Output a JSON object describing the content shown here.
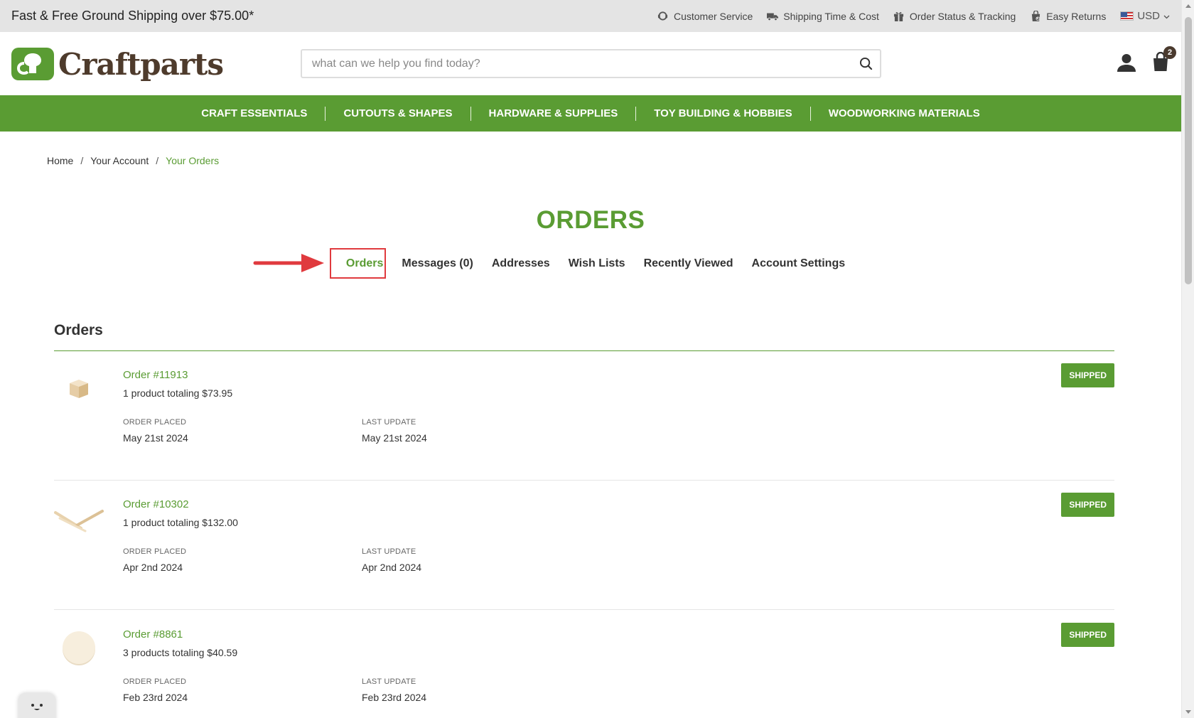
{
  "topbar": {
    "promo": "Fast & Free Ground Shipping over $75.00*",
    "links": [
      {
        "label": "Customer Service",
        "icon": "headset-icon"
      },
      {
        "label": "Shipping Time & Cost",
        "icon": "truck-icon"
      },
      {
        "label": "Order Status & Tracking",
        "icon": "gift-icon"
      },
      {
        "label": "Easy Returns",
        "icon": "return-bag-icon"
      }
    ],
    "currency": "USD"
  },
  "header": {
    "logo_text": "Craftparts",
    "search_placeholder": "what can we help you find today?",
    "cart_count": "2"
  },
  "nav": {
    "items": [
      "CRAFT ESSENTIALS",
      "CUTOUTS & SHAPES",
      "HARDWARE & SUPPLIES",
      "TOY BUILDING & HOBBIES",
      "WOODWORKING MATERIALS"
    ]
  },
  "breadcrumb": {
    "items": [
      "Home",
      "Your Account",
      "Your Orders"
    ],
    "separator": "/"
  },
  "page_title": "ORDERS",
  "tabs": [
    "Orders",
    "Messages (0)",
    "Addresses",
    "Wish Lists",
    "Recently Viewed",
    "Account Settings"
  ],
  "active_tab": "Orders",
  "orders_section": {
    "title": "Orders",
    "placed_label": "ORDER PLACED",
    "update_label": "LAST UPDATE",
    "orders": [
      {
        "number": "Order #11913",
        "total": "1 product totaling $73.95",
        "placed": "May 21st 2024",
        "updated": "May 21st 2024",
        "status": "SHIPPED",
        "thumb": "wood-cube"
      },
      {
        "number": "Order #10302",
        "total": "1 product totaling $132.00",
        "placed": "Apr 2nd 2024",
        "updated": "Apr 2nd 2024",
        "status": "SHIPPED",
        "thumb": "wood-dowels"
      },
      {
        "number": "Order #8861",
        "total": "3 products totaling $40.59",
        "placed": "Feb 23rd 2024",
        "updated": "Feb 23rd 2024",
        "status": "SHIPPED",
        "thumb": "wood-circle"
      }
    ]
  },
  "colors": {
    "brand_green": "#5a9c33",
    "brand_brown": "#4e3b2c",
    "annotation_red": "#e03a3e"
  }
}
